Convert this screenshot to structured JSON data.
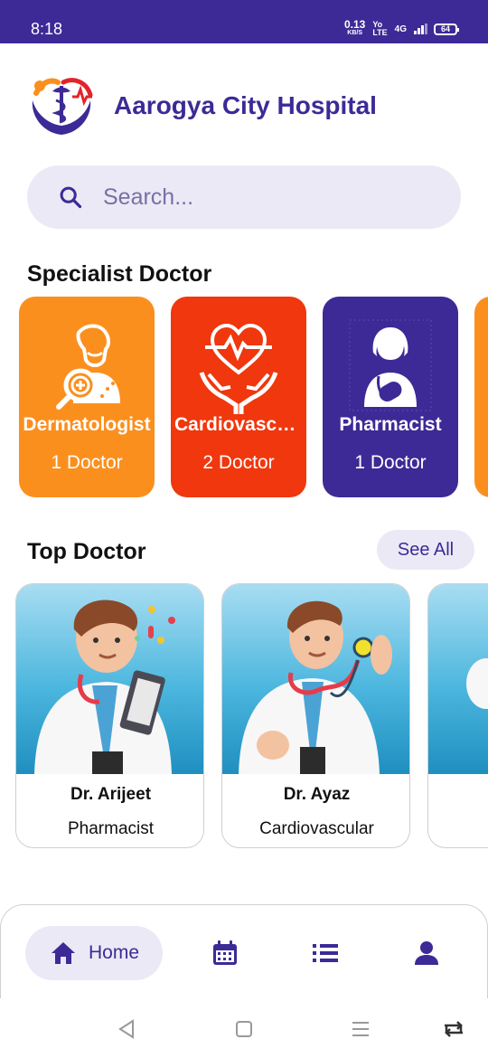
{
  "status_bar": {
    "time": "8:18",
    "net_speed": "0.13",
    "net_unit": "KB/S",
    "volte_top": "Yo",
    "volte_bottom": "LTE",
    "network": "4G",
    "battery": "64"
  },
  "header": {
    "hospital_name": "Aarogya City Hospital"
  },
  "search": {
    "placeholder": "Search..."
  },
  "specialist": {
    "title": "Specialist Doctor",
    "cards": [
      {
        "name": "Dermatologist",
        "count": "1 Doctor",
        "color": "#fb8f1e"
      },
      {
        "name": "Cardiovascu...",
        "count": "2 Doctor",
        "color": "#f0370d"
      },
      {
        "name": "Pharmacist",
        "count": "1 Doctor",
        "color": "#3d2a96"
      }
    ]
  },
  "top_doctor": {
    "title": "Top Doctor",
    "see_all": "See All",
    "doctors": [
      {
        "name": "Dr. Arijeet",
        "specialty": "Pharmacist"
      },
      {
        "name": "Dr. Ayaz",
        "specialty": "Cardiovascular"
      }
    ]
  },
  "bottom_nav": {
    "home_label": "Home",
    "items": [
      "home-icon",
      "calendar-icon",
      "list-icon",
      "person-icon"
    ]
  },
  "colors": {
    "primary": "#3d2a96",
    "light": "#ebe9f5"
  }
}
